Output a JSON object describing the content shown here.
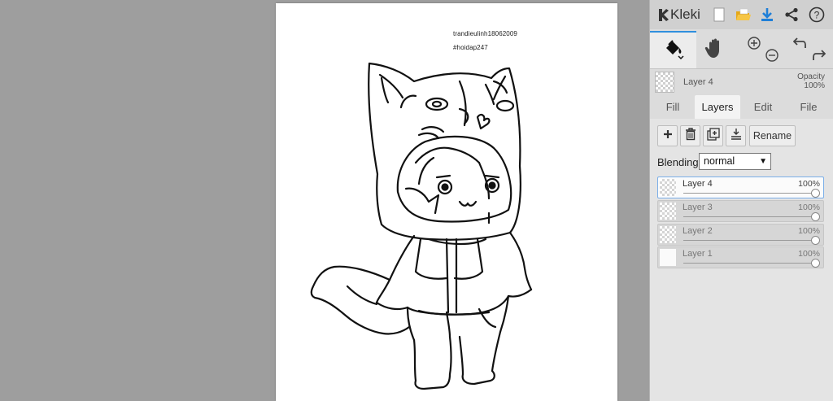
{
  "canvas": {
    "signature_name": "trandieulinh18062009",
    "signature_tag": "#hoidap247"
  },
  "app": {
    "logo_text": "Kleki",
    "top_icons": [
      "new-image-icon",
      "open-folder-icon",
      "download-icon",
      "share-icon",
      "help-icon"
    ],
    "accent_color": "#2f8fdd"
  },
  "tools": [
    "fill-bucket-icon",
    "hand-icon",
    "zoom-in-icon",
    "zoom-out-icon",
    "undo-icon",
    "redo-icon"
  ],
  "current_layer": {
    "name": "Layer 4",
    "opacity_label": "Opacity",
    "opacity_value": "100%"
  },
  "tabs": {
    "fill": "Fill",
    "layers": "Layers",
    "edit": "Edit",
    "file": "File",
    "active": "Layers"
  },
  "layer_controls": {
    "rename": "Rename",
    "icons": [
      "add-layer-icon",
      "delete-layer-icon",
      "duplicate-layer-icon",
      "merge-down-icon"
    ]
  },
  "blending": {
    "label": "Blending",
    "value": "normal"
  },
  "layers": [
    {
      "name": "Layer 4",
      "opacity": "100%",
      "opacity_level": 1.0,
      "active": true
    },
    {
      "name": "Layer 3",
      "opacity": "100%",
      "opacity_level": 1.0,
      "active": false
    },
    {
      "name": "Layer 2",
      "opacity": "100%",
      "opacity_level": 1.0,
      "active": false
    },
    {
      "name": "Layer 1",
      "opacity": "100%",
      "opacity_level": 1.0,
      "active": false
    }
  ]
}
